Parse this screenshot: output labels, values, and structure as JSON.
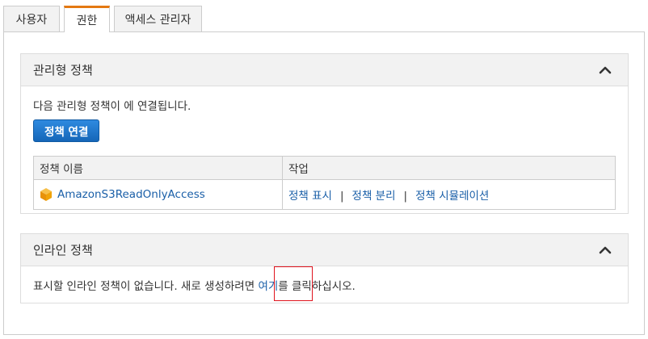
{
  "tabs": [
    {
      "label": "사용자",
      "active": false
    },
    {
      "label": "권한",
      "active": true
    },
    {
      "label": "액세스 관리자",
      "active": false
    }
  ],
  "managed": {
    "title": "관리형 정책",
    "description": "다음 관리형 정책이 에 연결됩니다.",
    "attach_button": "정책 연결",
    "columns": [
      "정책 이름",
      "작업"
    ],
    "rows": [
      {
        "name": "AmazonS3ReadOnlyAccess",
        "icon": "aws-policy-cube-icon",
        "actions": [
          "정책 표시",
          "정책 분리",
          "정책 시뮬레이션"
        ]
      }
    ],
    "separator": "|"
  },
  "inline": {
    "title": "인라인 정책",
    "text_before": "표시할 인라인 정책이 없습니다. 새로 생성하려면 ",
    "link": "여기",
    "text_after": "를 클릭하십시오."
  },
  "colors": {
    "accent_tab": "#e47911",
    "link": "#1a5fa8",
    "primary_button": "#1a73c6",
    "highlight_box": "#e0141e",
    "policy_icon": "#f0a30a"
  }
}
